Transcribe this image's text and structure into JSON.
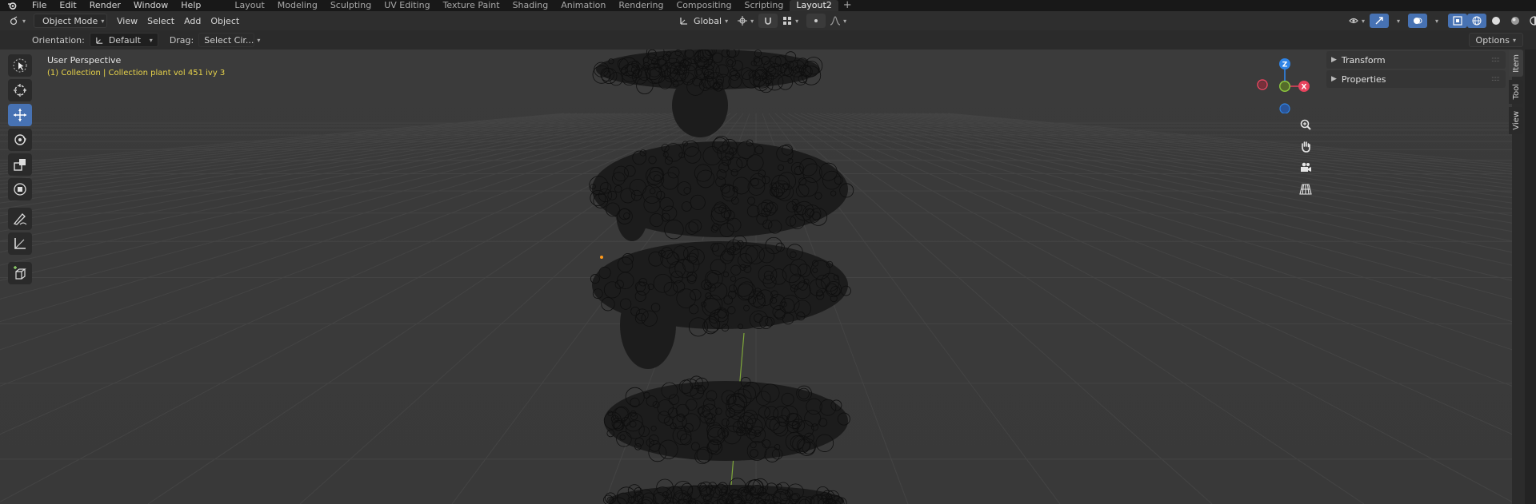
{
  "topbar": {
    "menus": [
      "File",
      "Edit",
      "Render",
      "Window",
      "Help"
    ],
    "workspaces": [
      "Layout",
      "Modeling",
      "Sculpting",
      "UV Editing",
      "Texture Paint",
      "Shading",
      "Animation",
      "Rendering",
      "Compositing",
      "Scripting",
      "Layout2"
    ],
    "active_workspace": "Layout2",
    "add_tab": "+"
  },
  "header": {
    "mode": "Object Mode",
    "menus": [
      "View",
      "Select",
      "Add",
      "Object"
    ],
    "transform_orientation": "Global",
    "options_label": "Options"
  },
  "subheader": {
    "orientation_label": "Orientation:",
    "orientation_value": "Default",
    "drag_label": "Drag:",
    "drag_value": "Select Cir..."
  },
  "viewport": {
    "perspective": "User Perspective",
    "collection": "(1) Collection | Collection plant vol 451 ivy 3"
  },
  "gizmo": {
    "z": "Z",
    "x": "X"
  },
  "npanel": {
    "panels": [
      "Transform",
      "Properties"
    ],
    "tabs": [
      "Item",
      "Tool",
      "View"
    ],
    "active_tab": "Item"
  },
  "colors": {
    "accent": "#4772b3",
    "collection_text": "#e6d24a",
    "axis_x": "#e8435d",
    "axis_y": "#8cc63f",
    "axis_z": "#2f84e6"
  }
}
